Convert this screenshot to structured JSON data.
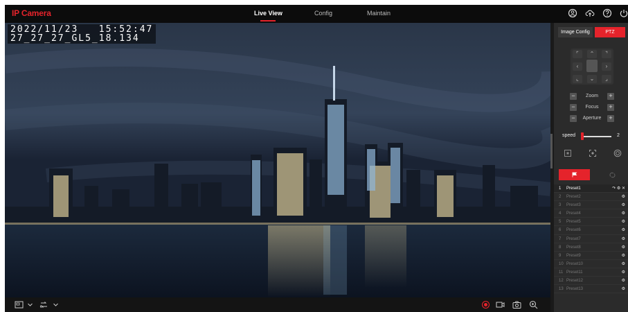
{
  "app": {
    "title": "IP Camera"
  },
  "nav": {
    "tabs": [
      {
        "label": "Live View"
      },
      {
        "label": "Config"
      },
      {
        "label": "Maintain"
      }
    ]
  },
  "header_icons": [
    "account-icon",
    "cloud-upload-icon",
    "help-icon",
    "power-icon"
  ],
  "osd": {
    "line1": "2022/11/23   15:52:47",
    "line2": "27_27_27_GL5_18.134"
  },
  "panel": {
    "tabs": [
      {
        "label": "Image Config"
      },
      {
        "label": "PTZ"
      }
    ],
    "zoom_label": "Zoom",
    "focus_label": "Focus",
    "aperture_label": "Aperture",
    "speed_label": "speed",
    "speed_value": "2",
    "presets": [
      {
        "num": "1",
        "name": "Preset1"
      },
      {
        "num": "2",
        "name": "Preset2"
      },
      {
        "num": "3",
        "name": "Preset3"
      },
      {
        "num": "4",
        "name": "Preset4"
      },
      {
        "num": "5",
        "name": "Preset5"
      },
      {
        "num": "6",
        "name": "Preset6"
      },
      {
        "num": "7",
        "name": "Preset7"
      },
      {
        "num": "8",
        "name": "Preset8"
      },
      {
        "num": "9",
        "name": "Preset9"
      },
      {
        "num": "10",
        "name": "Preset10"
      },
      {
        "num": "11",
        "name": "Preset11"
      },
      {
        "num": "12",
        "name": "Preset12"
      },
      {
        "num": "13",
        "name": "Preset13"
      }
    ]
  },
  "colors": {
    "accent": "#e5232b",
    "topbar": "#0c0c0c",
    "panel": "#2b2b2b"
  }
}
